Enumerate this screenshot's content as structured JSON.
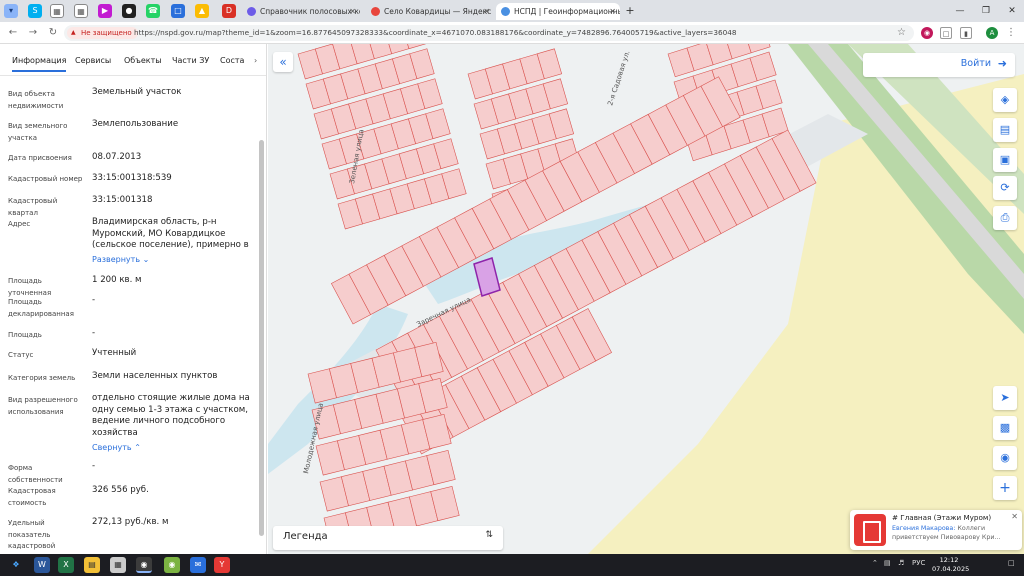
{
  "browser": {
    "tabs": [
      {
        "title": "Справочник полосовых кокс",
        "color": "#6d5ce8"
      },
      {
        "title": "Село Ковардицы — Яндекс К",
        "color": "#e8453c"
      },
      {
        "title": "НСПД | Геоинформационный",
        "color": "#4a90e2"
      }
    ],
    "security_label": "Не защищено",
    "url": "https://nspd.gov.ru/map?theme_id=1&zoom=16.877645097328333&coordinate_x=4671070.083188176&coordinate_y=7482896.764005719&active_layers=36048",
    "profile_initial": "A"
  },
  "panel": {
    "tabs": [
      "Информация",
      "Сервисы",
      "Объекты",
      "Части ЗУ",
      "Соста"
    ],
    "rows": [
      {
        "label": "Вид объекта недвижимости",
        "value": "Земельный участок"
      },
      {
        "label": "Вид земельного участка",
        "value": "Землепользование"
      },
      {
        "label": "Дата присвоения",
        "value": "08.07.2013"
      },
      {
        "label": "Кадастровый номер",
        "value": "33:15:001318:539"
      },
      {
        "label": "Кадастровый квартал",
        "value": "33:15:001318"
      },
      {
        "label": "Адрес",
        "value": "Владимирская область, р-н Муромский, МО Ковардицкое (сельское поселение), примерно в"
      },
      {
        "label": "Площадь уточненная",
        "value": "1 200 кв. м"
      },
      {
        "label": "Площадь декларированная",
        "value": "-"
      },
      {
        "label": "Площадь",
        "value": "-"
      },
      {
        "label": "Статус",
        "value": "Учтенный"
      },
      {
        "label": "Категория земель",
        "value": "Земли населенных пунктов"
      },
      {
        "label": "Вид разрешенного использования",
        "value": "отдельно стоящие жилые дома на одну семью 1-3 этажа с участком, ведение личного подсобного хозяйства"
      },
      {
        "label": "Форма собственности",
        "value": "-"
      },
      {
        "label": "Кадастровая стоимость",
        "value": "326 556 руб."
      },
      {
        "label": "Удельный показатель кадастровой стоимости",
        "value": "272,13 руб./кв. м"
      }
    ],
    "expand_label": "Развернуть",
    "collapse_label": "Свернуть"
  },
  "map": {
    "login_label": "Войти",
    "legend_label": "Легенда",
    "streets": [
      "Зеленая улица",
      "2-я Садовая ул.",
      "Заречная улица",
      "Молодежная улица"
    ],
    "colors": {
      "parcel_fill": "#f6cdcd",
      "parcel_stroke": "#d9534f",
      "selected_fill": "#d9a2e6",
      "selected_stroke": "#8e24aa",
      "field": "#f5f0c0",
      "water": "#cde6ef",
      "accent": "#2a6fdb"
    }
  },
  "notification": {
    "title": "# Главная (Этажи Муром)",
    "author": "Евгения Макарова:",
    "text": "Коллеги приветствуем Пивоварову Кри..."
  },
  "taskbar": {
    "language": "РУС",
    "time": "12:12",
    "date": "07.04.2025"
  }
}
